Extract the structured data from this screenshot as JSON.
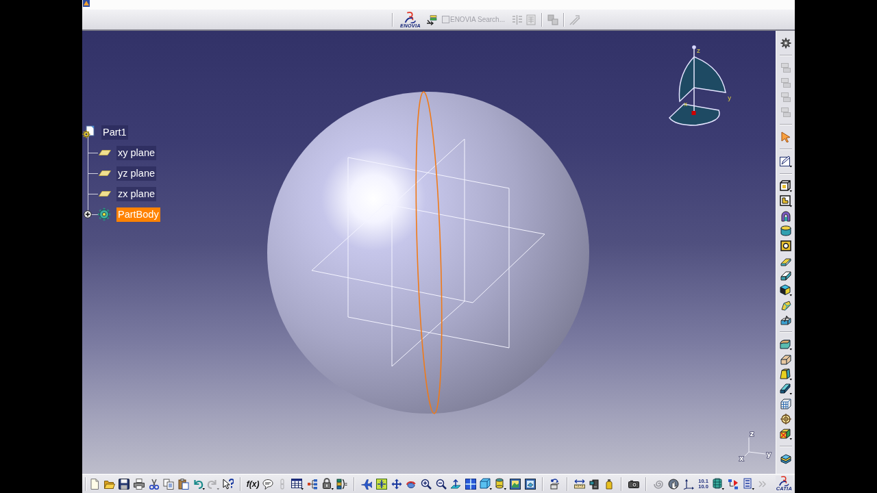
{
  "top_toolbar": {
    "logo_text": "ENOVIA",
    "search": {
      "checked": false,
      "disabled": true,
      "label": "ENOVIA Search..."
    },
    "buttons": [
      {
        "disabled": false
      },
      {
        "disabled": true
      },
      {
        "disabled": true
      },
      {
        "disabled": true
      },
      {
        "disabled": true
      }
    ]
  },
  "tree": {
    "label": "Part1",
    "children": [
      {
        "kind": "plane",
        "label": "xy plane",
        "selected": false
      },
      {
        "kind": "plane",
        "label": "yz plane",
        "selected": false
      },
      {
        "kind": "plane",
        "label": "zx plane",
        "selected": false
      },
      {
        "kind": "body",
        "label": "PartBody",
        "selected": true,
        "expanded": false
      }
    ]
  },
  "compass": {
    "z_label": "z",
    "y_label": "y",
    "x_label": "x"
  },
  "axis_triad": {
    "z_label": "z",
    "y_label": "y",
    "x_label": "x"
  },
  "right_toolbar": {
    "buttons": [
      {
        "disabled": false
      },
      {
        "disabled": true
      },
      {
        "disabled": true
      },
      {
        "disabled": true
      },
      {
        "disabled": true
      },
      {
        "disabled": false
      },
      {
        "disabled": false
      },
      {
        "disabled": false
      },
      {
        "disabled": false
      },
      {
        "disabled": false
      },
      {
        "disabled": false
      },
      {
        "disabled": false
      },
      {
        "disabled": false
      },
      {
        "disabled": false
      },
      {
        "disabled": false
      },
      {
        "disabled": false
      },
      {
        "disabled": false
      },
      {
        "disabled": false
      },
      {
        "disabled": false
      },
      {
        "disabled": false
      },
      {
        "disabled": false
      },
      {
        "disabled": false
      },
      {
        "disabled": false
      },
      {
        "disabled": false
      },
      {
        "disabled": false
      }
    ]
  },
  "bottom_toolbar": {
    "buttons": [
      {
        "disabled": false
      },
      {
        "disabled": false
      },
      {
        "disabled": false
      },
      {
        "disabled": false
      },
      {
        "disabled": false
      },
      {
        "disabled": false
      },
      {
        "disabled": false
      },
      {
        "disabled": false
      },
      {
        "disabled": true
      },
      {
        "disabled": false
      },
      {
        "disabled": false,
        "label": "f(x)"
      },
      {
        "disabled": false
      },
      {
        "disabled": true
      },
      {
        "disabled": false
      },
      {
        "disabled": false
      },
      {
        "disabled": false
      },
      {
        "disabled": false
      },
      {
        "disabled": false
      },
      {
        "disabled": false
      },
      {
        "disabled": false
      },
      {
        "disabled": false
      },
      {
        "disabled": false
      },
      {
        "disabled": false
      },
      {
        "disabled": false
      },
      {
        "disabled": false
      },
      {
        "disabled": false
      },
      {
        "disabled": false
      },
      {
        "disabled": false
      },
      {
        "disabled": false
      },
      {
        "disabled": false
      },
      {
        "disabled": false
      },
      {
        "disabled": false
      },
      {
        "disabled": false
      },
      {
        "disabled": false
      },
      {
        "disabled": false
      },
      {
        "disabled": false
      },
      {
        "disabled": false
      },
      {
        "disabled": false,
        "lines": [
          "10.1",
          "10.0"
        ]
      },
      {
        "disabled": false
      },
      {
        "disabled": false
      },
      {
        "disabled": false
      },
      {
        "disabled": true
      }
    ],
    "logo_text": "CATIA"
  }
}
